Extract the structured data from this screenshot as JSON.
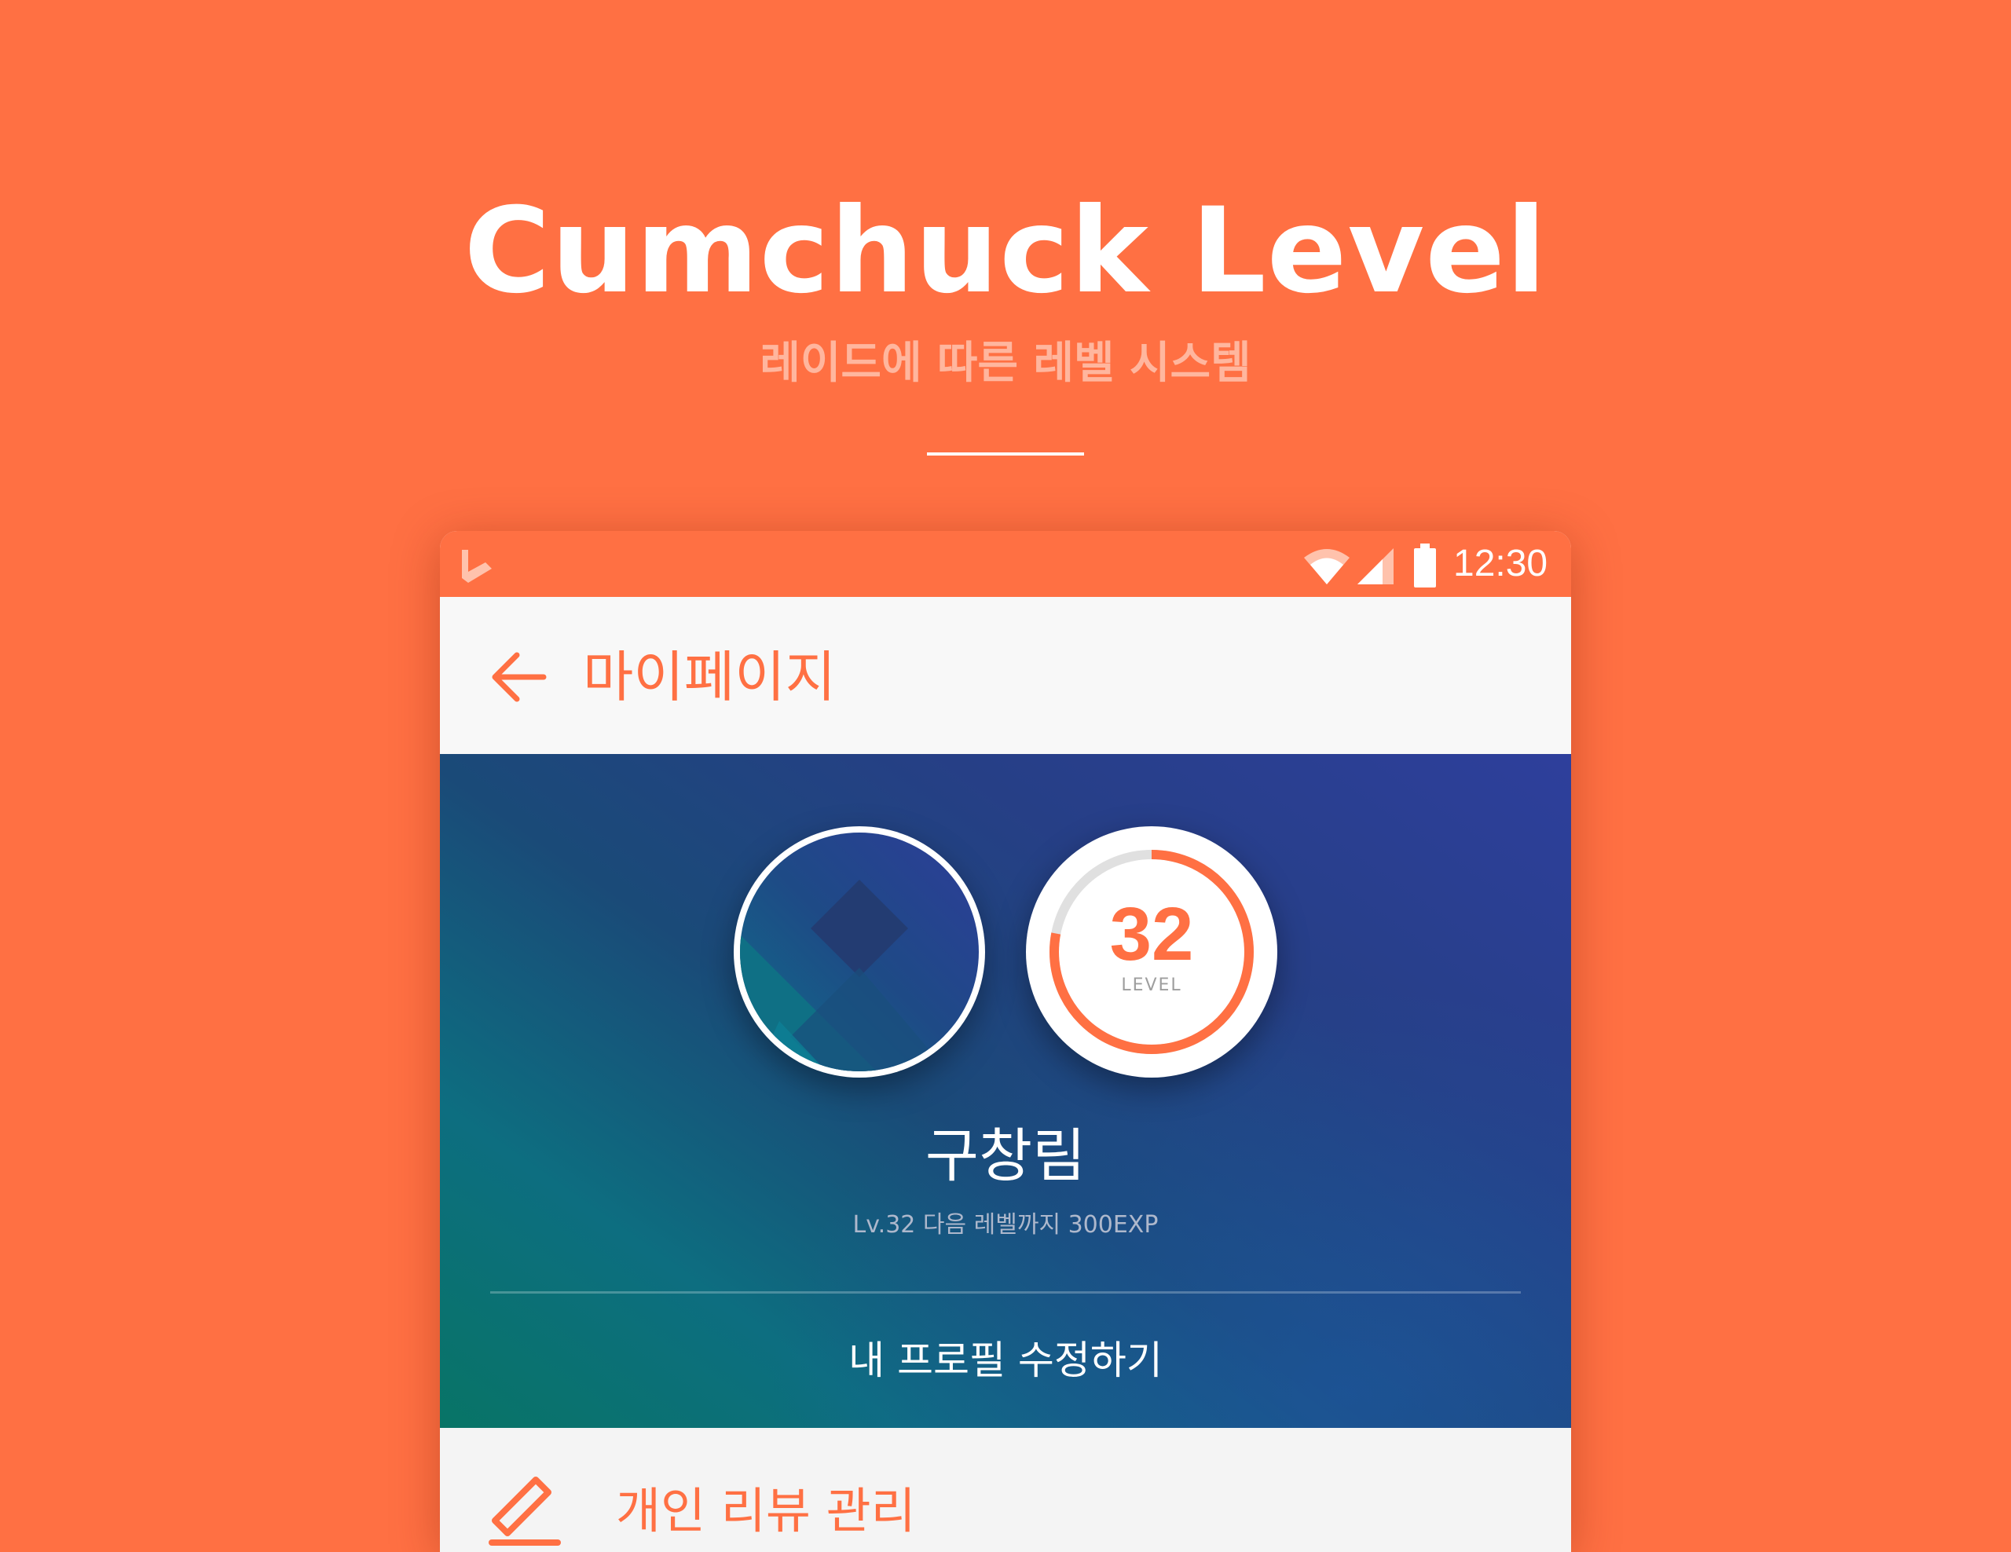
{
  "hero": {
    "title": "Cumchuck Level",
    "subtitle": "레이드에 따른 레벨 시스템"
  },
  "status_bar": {
    "time": "12:30",
    "icons": [
      "app-logo-icon",
      "wifi-icon",
      "signal-icon",
      "battery-icon"
    ]
  },
  "app_bar": {
    "back_icon": "arrow-left-icon",
    "title": "마이페이지"
  },
  "profile": {
    "name": "구창림",
    "level_info": "Lv.32 다음 레벨까지 300EXP",
    "level": {
      "number": "32",
      "label": "LEVEL",
      "progress": 0.78
    },
    "edit_button": "내 프로필 수정하기"
  },
  "menu": {
    "items": [
      {
        "icon": "pencil-icon",
        "label": "개인 리뷰 관리"
      }
    ]
  },
  "colors": {
    "accent": "#FF7043",
    "card_gradient_start": "#2E3F9C",
    "card_gradient_end": "#087466",
    "ring_track": "#E0E0E0"
  }
}
